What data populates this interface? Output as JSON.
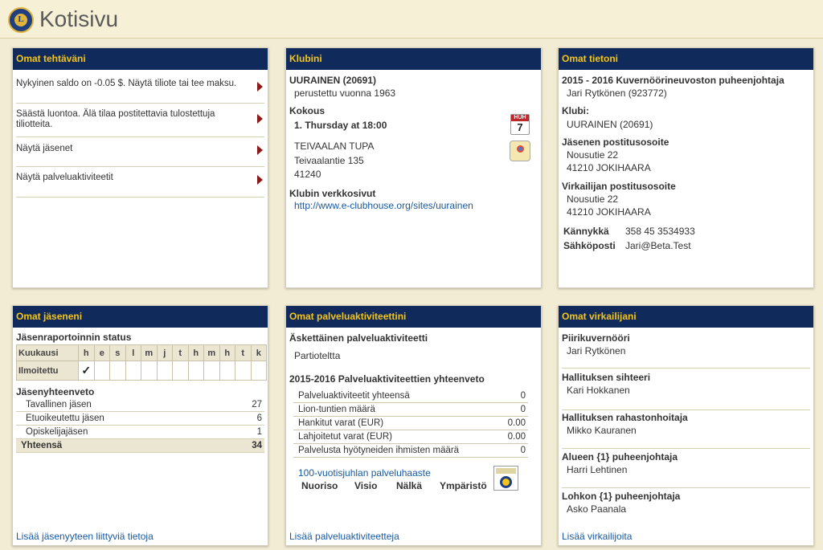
{
  "page": {
    "title": "Kotisivu",
    "logo_text": "L"
  },
  "tasks": {
    "header": "Omat tehtäväni",
    "items": [
      "Nykyinen saldo on -0.05 $. Näytä tiliote tai tee maksu.",
      "Säästä luontoa. Älä tilaa postitettavia tulostettuja tiliotteita.",
      "Näytä jäsenet",
      "Näytä palveluaktiviteetit"
    ]
  },
  "club": {
    "header": "Klubini",
    "name": "UURAINEN (20691)",
    "founded": "perustettu vuonna 1963",
    "meeting_label": "Kokous",
    "meeting_time": "1. Thursday at 18:00",
    "cal_month": "HUH",
    "cal_day": "7",
    "venue": "TEIVAALAN TUPA",
    "street": "Teivaalantie 135",
    "zip": "41240",
    "website_label": "Klubin verkkosivut",
    "website_url": "http://www.e-clubhouse.org/sites/uurainen"
  },
  "info": {
    "header": "Omat tietoni",
    "role": "2015 - 2016 Kuvernöörineuvoston puheenjohtaja",
    "person": "Jari Rytkönen (923772)",
    "club_label": "Klubi:",
    "club_value": "UURAINEN (20691)",
    "member_addr_label": "Jäsenen postitusosoite",
    "member_addr_1": "Nousutie 22",
    "member_addr_2": "41210 JOKIHAARA",
    "officer_addr_label": "Virkailijan postitusosoite",
    "officer_addr_1": "Nousutie 22",
    "officer_addr_2": "41210 JOKIHAARA",
    "mobile_label": "Kännykkä",
    "mobile_value": "358 45 3534933",
    "email_label": "Sähköposti",
    "email_value": "Jari@Beta.Test"
  },
  "members": {
    "header": "Omat jäseneni",
    "report_label": "Jäsenraportoinnin status",
    "month_label": "Kuukausi",
    "months": [
      "h",
      "e",
      "s",
      "l",
      "m",
      "j",
      "t",
      "h",
      "m",
      "h",
      "t",
      "k"
    ],
    "reported_label": "Ilmoitettu",
    "reported_mark": "✓",
    "summary_label": "Jäsenyhteenveto",
    "rows": [
      {
        "label": "Tavallinen jäsen",
        "value": "27"
      },
      {
        "label": "Etuoikeutettu jäsen",
        "value": "6"
      },
      {
        "label": "Opiskelijajäsen",
        "value": "1"
      }
    ],
    "total_label": "Yhteensä",
    "total_value": "34",
    "more_link": "Lisää jäsenyyteen liittyviä tietoja"
  },
  "service": {
    "header": "Omat palveluaktiviteettini",
    "recent_label": "Äskettäinen palveluaktiviteetti",
    "recent_value": "Partioteltta",
    "summary_label": "2015-2016 Palveluaktiviteettien yhteenveto",
    "rows": [
      {
        "label": "Palveluaktiviteetit yhteensä",
        "value": "0"
      },
      {
        "label": "Lion-tuntien määrä",
        "value": "0"
      },
      {
        "label": "Hankitut varat (EUR)",
        "value": "0.00"
      },
      {
        "label": "Lahjoitetut varat (EUR)",
        "value": "0.00"
      },
      {
        "label": "Palvelusta hyötyneiden ihmisten määrä",
        "value": "0"
      }
    ],
    "challenge_link": "100-vuotisjuhlan palveluhaaste",
    "categories": [
      "Nuoriso",
      "Visio",
      "Nälkä",
      "Ympäristö"
    ],
    "more_link": "Lisää palveluaktiviteetteja"
  },
  "officers": {
    "header": "Omat virkailijani",
    "items": [
      {
        "title": "Piirikuvernööri",
        "name": "Jari Rytkönen"
      },
      {
        "title": "Hallituksen sihteeri",
        "name": "Kari Hokkanen"
      },
      {
        "title": "Hallituksen rahastonhoitaja",
        "name": "Mikko Kauranen"
      },
      {
        "title": "Alueen {1} puheenjohtaja",
        "name": "Harri Lehtinen"
      },
      {
        "title": "Lohkon {1} puheenjohtaja",
        "name": "Asko Paanala"
      }
    ],
    "more_link": "Lisää virkailijoita"
  },
  "colors": {
    "panel_header_bg": "#102a5c",
    "panel_header_text": "#f5c518",
    "link": "#1a5aa0",
    "arrow": "#8b1a1a"
  }
}
